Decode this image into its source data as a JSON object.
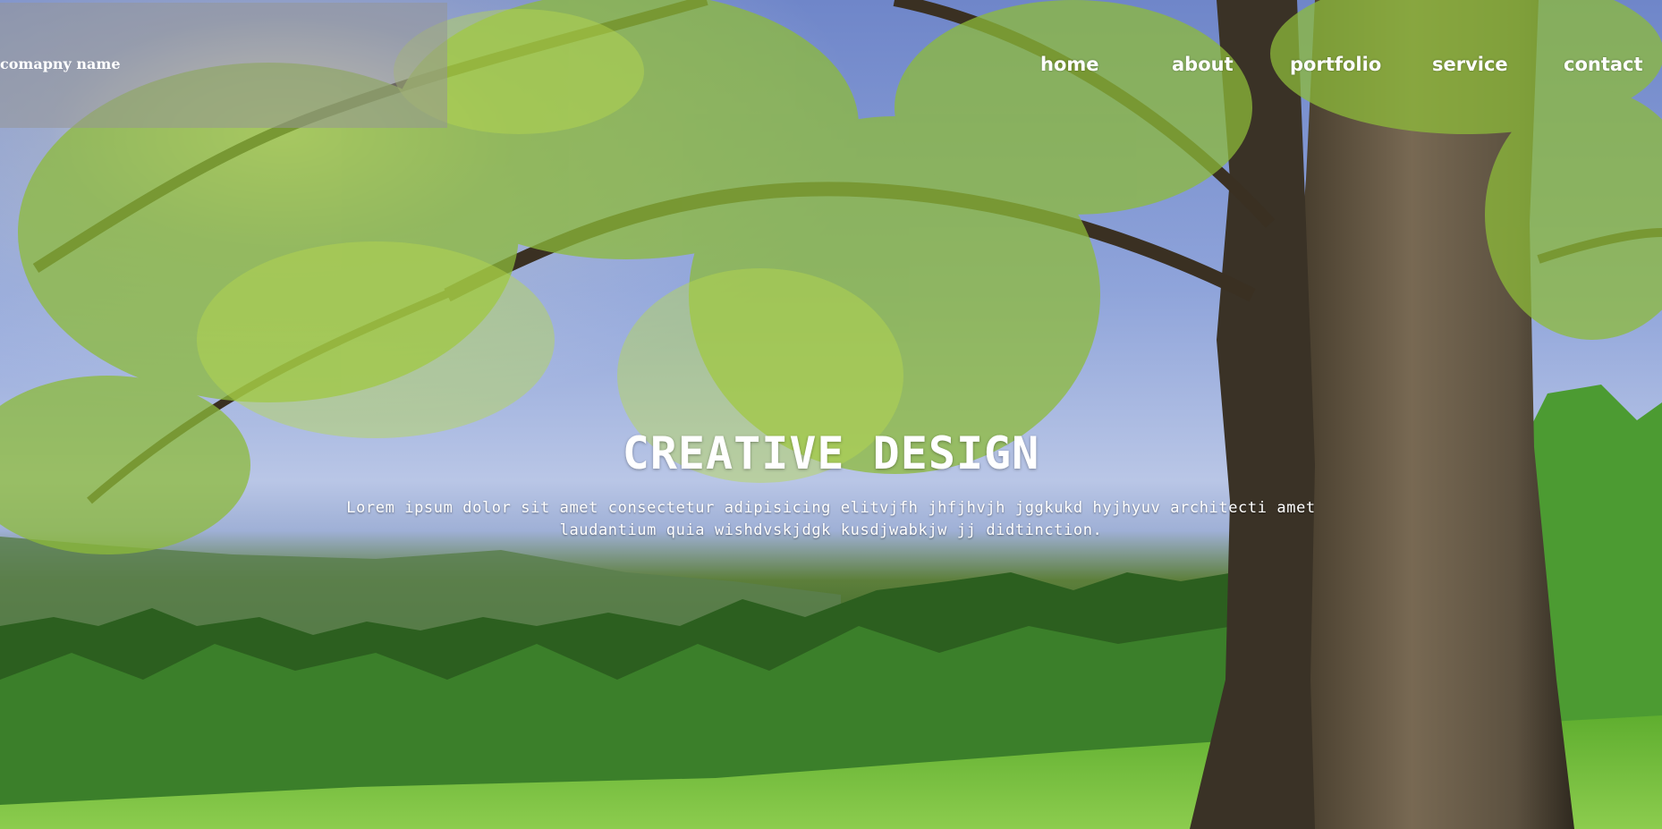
{
  "header": {
    "company_name": "comapny name"
  },
  "nav": {
    "items": [
      {
        "label": "home"
      },
      {
        "label": "about"
      },
      {
        "label": "portfolio"
      },
      {
        "label": "service"
      },
      {
        "label": "contact"
      }
    ]
  },
  "hero": {
    "title": "CREATIVE DESIGN",
    "description": "Lorem ipsum dolor sit amet consectetur adipisicing elitvjfh jhfjhvjh jggkukd hyjhyuv architecti amet laudantium quia wishdvskjdgk kusdjwabkjw jj didtinction."
  },
  "colors": {
    "text": "#ffffff",
    "header_overlay": "#969696"
  }
}
